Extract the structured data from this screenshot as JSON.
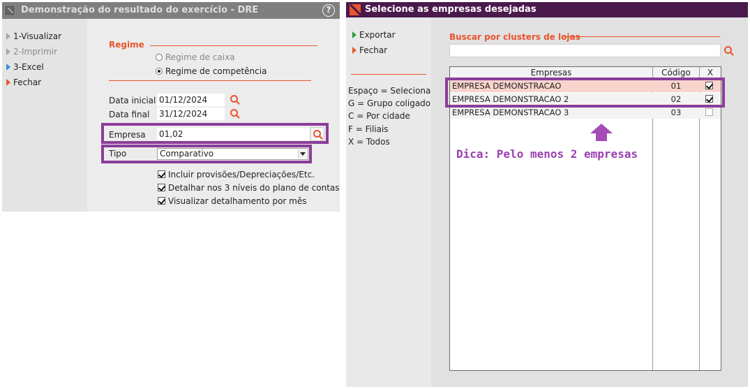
{
  "left_window": {
    "title": "Demonstração do resultado do exercício - DRE",
    "help_label": "?",
    "menu": [
      {
        "label": "1-Visualizar",
        "icon": "triangle-gray-icon",
        "enabled": true
      },
      {
        "label": "2-Imprimir",
        "icon": "triangle-gray-icon",
        "enabled": false
      },
      {
        "label": "3-Excel",
        "icon": "triangle-blue-icon",
        "enabled": true
      },
      {
        "label": "Fechar",
        "icon": "triangle-orange-icon",
        "enabled": true
      }
    ],
    "regime": {
      "title": "Regime",
      "options": [
        {
          "label": "Regime de caixa",
          "selected": false,
          "enabled": false
        },
        {
          "label": "Regime de competência",
          "selected": true,
          "enabled": true
        }
      ]
    },
    "data_inicial": {
      "label": "Data inicial",
      "value": "01/12/2024"
    },
    "data_final": {
      "label": "Data final",
      "value": "31/12/2024"
    },
    "empresa": {
      "label": "Empresa",
      "value": "01,02"
    },
    "tipo": {
      "label": "Tipo",
      "value": "Comparativo"
    },
    "checkboxes": [
      {
        "label": "Incluir provisões/Depreciações/Etc.",
        "checked": true
      },
      {
        "label": "Detalhar nos 3 níveis do plano de contas",
        "checked": true
      },
      {
        "label": "Visualizar detalhamento por mês",
        "checked": true
      }
    ]
  },
  "right_window": {
    "title": "Selecione as empresas desejadas",
    "menu": [
      {
        "label": "Exportar",
        "icon": "triangle-green-icon"
      },
      {
        "label": "Fechar",
        "icon": "triangle-orange-icon"
      }
    ],
    "legend": [
      "Espaço = Selecionado",
      "G = Grupo coligado",
      "C = Por cidade",
      "F = Filiais",
      "X = Todos"
    ],
    "search": {
      "title": "Buscar por clusters de lojas",
      "value": ""
    },
    "grid": {
      "headers": {
        "name": "Empresas",
        "code": "Código",
        "x": "X"
      },
      "rows": [
        {
          "name": "EMPRESA DEMONSTRACAO",
          "code": "01",
          "checked": true
        },
        {
          "name": "EMPRESA DEMONSTRACAO 2",
          "code": "02",
          "checked": true
        },
        {
          "name": "EMPRESA DEMONSTRACAO 3",
          "code": "03",
          "checked": false
        }
      ]
    },
    "tip": "Dica: Pelo menos 2 empresas"
  },
  "colors": {
    "accent_orange": "#e8552f",
    "highlight_purple": "#8b3d9a",
    "title_bar_right": "#4a1a4c",
    "title_bar_left": "#7f7f7f",
    "selected_row": "#f9d4cc"
  }
}
